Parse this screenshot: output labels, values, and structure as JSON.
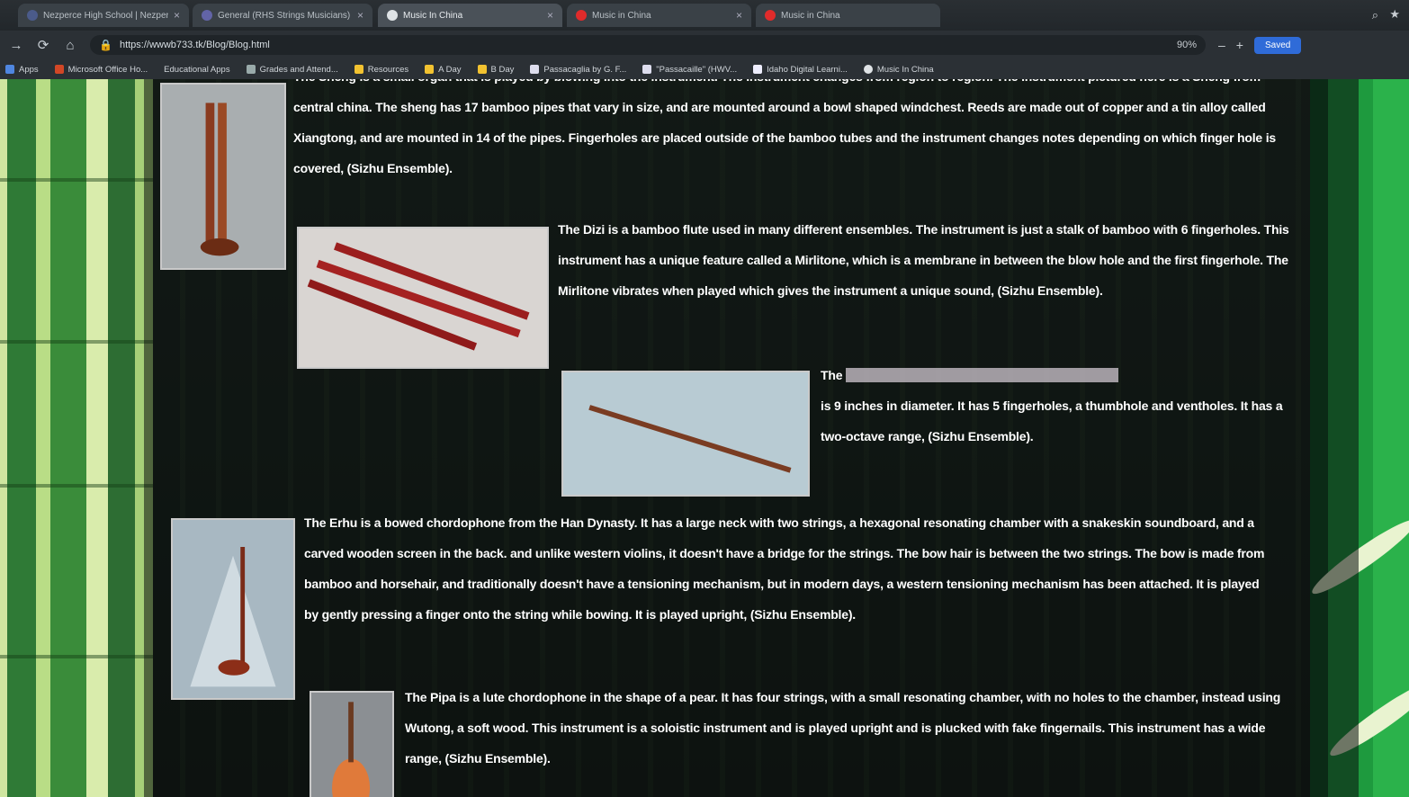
{
  "tabs": [
    {
      "label": "Nezperce High School | Nezperce",
      "active": false
    },
    {
      "label": "General (RHS Strings Musicians)",
      "active": false
    },
    {
      "label": "Music In China",
      "active": true
    },
    {
      "label": "Music in China",
      "active": false
    },
    {
      "label": "Music in China",
      "active": false
    }
  ],
  "url": "https://wwwb733.tk/Blog/Blog.html",
  "zoom": "90%",
  "sync_label": "Saved",
  "bookmarks": [
    "Apps",
    "Microsoft Office Ho...",
    "Educational Apps",
    "Grades and Attend...",
    "Resources",
    "A Day",
    "B Day",
    "Passacaglia by G. F...",
    "\"Passacaille\" (HWV...",
    "Idaho Digital Learni...",
    "Music In China"
  ],
  "articles": {
    "sheng": "The Sheng is a small organ that is played by blowing into the instrument. The instrument changes from region to region. The instrument pictured here is a Sheng from central china. The sheng has 17 bamboo pipes that vary in size, and are mounted around a bowl shaped windchest. Reeds are made out of copper and a tin alloy called Xiangtong, and are mounted in 14 of the pipes. Fingerholes are placed outside of the bamboo tubes and the instrument changes notes depending on which finger hole is covered, (Sizhu Ensemble).",
    "dizi": "The Dizi is a bamboo flute used in many different ensembles. The instrument is just a stalk of bamboo with 6 fingerholes. This instrument has a unique feature called a Mirlitone, which is a membrane in between the blow hole and the first fingerhole. The Mirlitone vibrates when played which gives the instrument a unique sound, (Sizhu Ensemble).",
    "xiao_start": "The",
    "xiao_end": "is 9 inches in diameter. It has 5 fingerholes, a thumbhole and ventholes. It has a two-octave range, (Sizhu Ensemble).",
    "erhu": "The Erhu is a bowed chordophone from the Han Dynasty. It has a large neck with two strings, a hexagonal resonating chamber with a snakeskin soundboard, and a carved wooden screen in the back. and unlike western violins, it doesn't have a bridge for the strings. The bow hair is between the two strings. The bow is made from bamboo and horsehair, and traditionally doesn't have a tensioning mechanism, but in modern days, a western tensioning mechanism has been attached. It is played by gently pressing a finger onto the string while bowing. It is played upright, (Sizhu Ensemble).",
    "pipa": "The Pipa is a lute chordophone in the shape of a pear. It has four strings, with a small resonating chamber, with no holes to the chamber, instead using Wutong, a soft wood. This instrument is a soloistic instrument and is played upright and is plucked with fake fingernails. This instrument has a wide range, (Sizhu Ensemble)."
  },
  "colors": {
    "tab_active": "#4a5158",
    "sync": "#2f6bd8",
    "text": "#ffffff",
    "bamboo": "#2f7a36"
  }
}
